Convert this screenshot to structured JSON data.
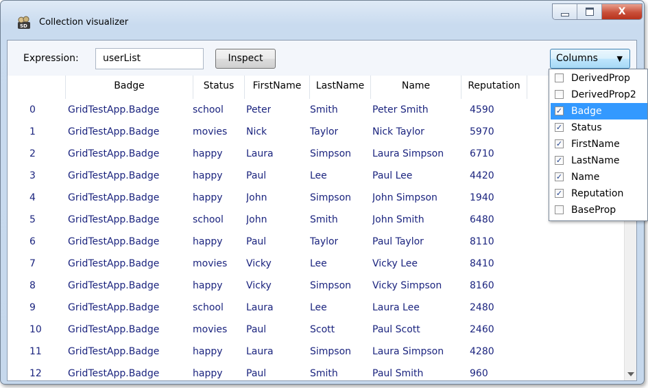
{
  "window": {
    "title": "Collection visualizer",
    "close_glyph": "X"
  },
  "toolbar": {
    "expression_label": "Expression:",
    "expression_value": "userList",
    "inspect_label": "Inspect",
    "columns_label": "Columns",
    "columns_arrow": "▼"
  },
  "grid": {
    "headers": [
      "",
      "Badge",
      "Status",
      "FirstName",
      "LastName",
      "Name",
      "Reputation"
    ],
    "rows": [
      [
        "0",
        "GridTestApp.Badge",
        "school",
        "Peter",
        "Smith",
        "Peter Smith",
        "4590"
      ],
      [
        "1",
        "GridTestApp.Badge",
        "movies",
        "Nick",
        "Taylor",
        "Nick Taylor",
        "5970"
      ],
      [
        "2",
        "GridTestApp.Badge",
        "happy",
        "Laura",
        "Simpson",
        "Laura Simpson",
        "6710"
      ],
      [
        "3",
        "GridTestApp.Badge",
        "happy",
        "Paul",
        "Lee",
        "Paul Lee",
        "4420"
      ],
      [
        "4",
        "GridTestApp.Badge",
        "happy",
        "John",
        "Simpson",
        "John Simpson",
        "1940"
      ],
      [
        "5",
        "GridTestApp.Badge",
        "school",
        "John",
        "Smith",
        "John Smith",
        "6480"
      ],
      [
        "6",
        "GridTestApp.Badge",
        "happy",
        "Paul",
        "Taylor",
        "Paul Taylor",
        "8110"
      ],
      [
        "7",
        "GridTestApp.Badge",
        "movies",
        "Vicky",
        "Lee",
        "Vicky Lee",
        "8410"
      ],
      [
        "8",
        "GridTestApp.Badge",
        "happy",
        "Vicky",
        "Simpson",
        "Vicky Simpson",
        "8160"
      ],
      [
        "9",
        "GridTestApp.Badge",
        "school",
        "Laura",
        "Lee",
        "Laura Lee",
        "2480"
      ],
      [
        "10",
        "GridTestApp.Badge",
        "movies",
        "Paul",
        "Scott",
        "Paul Scott",
        "2460"
      ],
      [
        "11",
        "GridTestApp.Badge",
        "happy",
        "Laura",
        "Simpson",
        "Laura Simpson",
        "4280"
      ],
      [
        "12",
        "GridTestApp.Badge",
        "happy",
        "Paul",
        "Smith",
        "Paul Smith",
        "960"
      ]
    ]
  },
  "columns_menu": {
    "items": [
      {
        "label": "DerivedProp",
        "checked": false,
        "selected": false
      },
      {
        "label": "DerivedProp2",
        "checked": false,
        "selected": false
      },
      {
        "label": "Badge",
        "checked": true,
        "selected": true
      },
      {
        "label": "Status",
        "checked": true,
        "selected": false
      },
      {
        "label": "FirstName",
        "checked": true,
        "selected": false
      },
      {
        "label": "LastName",
        "checked": true,
        "selected": false
      },
      {
        "label": "Name",
        "checked": true,
        "selected": false
      },
      {
        "label": "Reputation",
        "checked": true,
        "selected": false
      },
      {
        "label": "BaseProp",
        "checked": false,
        "selected": false
      }
    ]
  },
  "colors": {
    "cell_text": "#1a237e",
    "selection": "#3399ff"
  },
  "icons": {
    "app": "visualizer-app-icon",
    "minimize": "minimize-icon",
    "maximize": "maximize-icon",
    "close": "close-icon",
    "dropdown": "chevron-down-icon",
    "scroll_down": "scroll-down-arrow-icon"
  }
}
